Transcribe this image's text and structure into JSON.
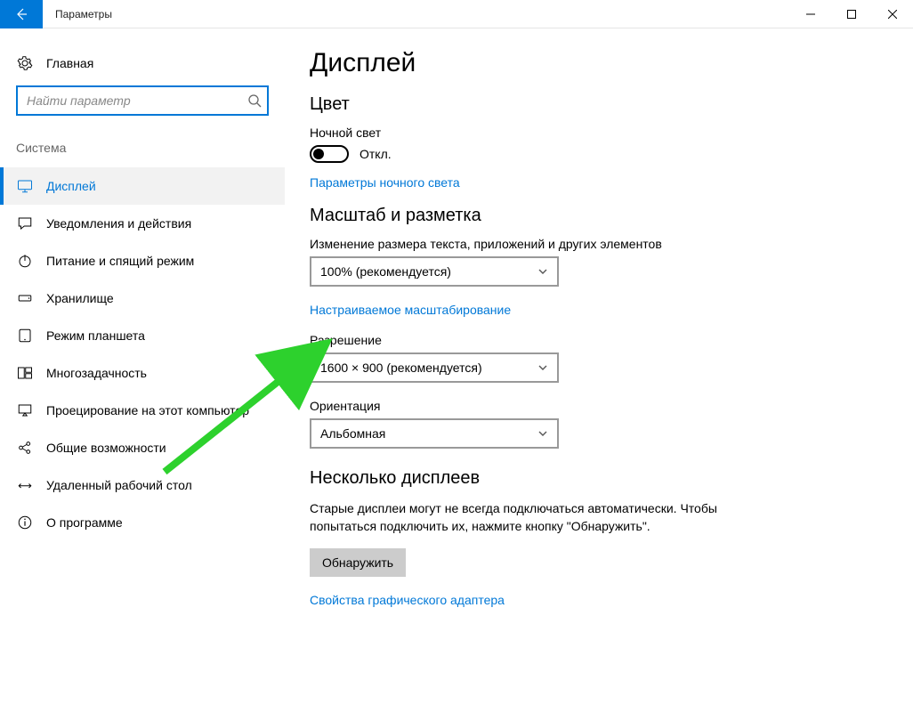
{
  "titlebar": {
    "title": "Параметры"
  },
  "sidebar": {
    "home_label": "Главная",
    "search_placeholder": "Найти параметр",
    "section_label": "Система",
    "items": [
      {
        "label": "Дисплей"
      },
      {
        "label": "Уведомления и действия"
      },
      {
        "label": "Питание и спящий режим"
      },
      {
        "label": "Хранилище"
      },
      {
        "label": "Режим планшета"
      },
      {
        "label": "Многозадачность"
      },
      {
        "label": "Проецирование на этот компьютер"
      },
      {
        "label": "Общие возможности"
      },
      {
        "label": "Удаленный рабочий стол"
      },
      {
        "label": "О программе"
      }
    ]
  },
  "main": {
    "page_title": "Дисплей",
    "color": {
      "heading": "Цвет",
      "night_light_label": "Ночной свет",
      "toggle_state": "Откл.",
      "night_light_settings": "Параметры ночного света"
    },
    "scale": {
      "heading": "Масштаб и разметка",
      "scale_label": "Изменение размера текста, приложений и других элементов",
      "scale_value": "100% (рекомендуется)",
      "custom_scaling_link": "Настраиваемое масштабирование",
      "resolution_label": "Разрешение",
      "resolution_value": "1600 × 900 (рекомендуется)",
      "orientation_label": "Ориентация",
      "orientation_value": "Альбомная"
    },
    "multi": {
      "heading": "Несколько дисплеев",
      "body": "Старые дисплеи могут не всегда подключаться автоматически. Чтобы попытаться подключить их, нажмите кнопку \"Обнаружить\".",
      "detect_button": "Обнаружить",
      "adapter_link": "Свойства графического адаптера"
    }
  }
}
